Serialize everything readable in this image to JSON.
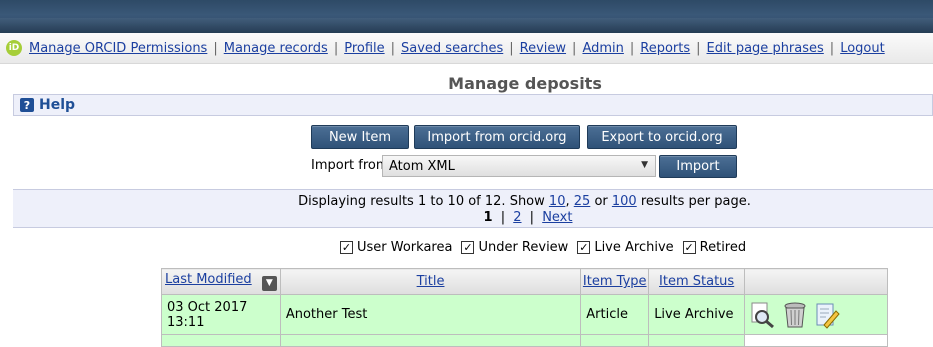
{
  "menu": {
    "orcid_icon": "orcid-icon",
    "items": [
      "Manage ORCID Permissions",
      "Manage records",
      "Profile",
      "Saved searches",
      "Review",
      "Admin",
      "Reports",
      "Edit page phrases",
      "Logout"
    ]
  },
  "page": {
    "title": "Manage deposits"
  },
  "help": {
    "label": "Help",
    "icon": "help-icon"
  },
  "buttons": {
    "new_item": "New Item",
    "import_orcid": "Import from orcid.org",
    "export_orcid": "Export to orcid.org",
    "import": "Import"
  },
  "import": {
    "label": "Import from",
    "selected": "Atom XML"
  },
  "results": {
    "text_prefix": "Displaying results 1 to 10 of 12. Show",
    "opt1": "10",
    "sep1": ",",
    "opt2": "25",
    "or": "or",
    "opt3": "100",
    "text_suffix": "results per page.",
    "current_page": "1",
    "page2": "2",
    "next": "Next",
    "pipe": "|"
  },
  "filters": [
    {
      "label": "User Workarea",
      "checked": true
    },
    {
      "label": "Under Review",
      "checked": true
    },
    {
      "label": "Live Archive",
      "checked": true
    },
    {
      "label": "Retired",
      "checked": true
    }
  ],
  "table": {
    "headers": [
      "Last Modified",
      "Title",
      "Item Type",
      "Item Status"
    ],
    "rows": [
      {
        "modified": "03 Oct 2017 13:11",
        "title": "Another Test",
        "type": "Article",
        "status": "Live Archive"
      }
    ]
  },
  "colors": {
    "banner": "#2e4a66",
    "button": "#3b5f86",
    "row_bg": "#ccffcc",
    "link": "#1b3fa0"
  }
}
